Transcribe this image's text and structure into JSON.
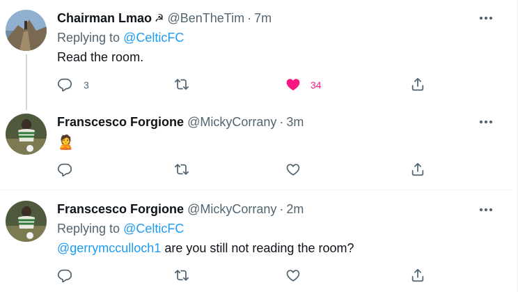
{
  "colors": {
    "text": "#0f1419",
    "secondary": "#536471",
    "link": "#1d9bf0",
    "like": "#f91880",
    "divider": "#eff3f4"
  },
  "tweets": [
    {
      "name": "Chairman Lmao",
      "name_emoji": "☭",
      "handle": "@BenTheTim",
      "dot": "·",
      "time": "7m",
      "replying_prefix": "Replying to",
      "replying_to": "@CelticFC",
      "body": "Read the room.",
      "reply_count": "3",
      "retweet_count": "",
      "like_count": "34",
      "liked": true
    },
    {
      "name": "Franscesco Forgione",
      "handle": "@MickyCorrany",
      "dot": "·",
      "time": "3m",
      "body_emoji": "🙎",
      "reply_count": "",
      "retweet_count": "",
      "like_count": "",
      "liked": false
    },
    {
      "name": "Franscesco Forgione",
      "handle": "@MickyCorrany",
      "dot": "·",
      "time": "2m",
      "replying_prefix": "Replying to",
      "replying_to": "@CelticFC",
      "mention": "@gerrymcculloch1",
      "body": " are you still not reading the room?",
      "reply_count": "",
      "retweet_count": "",
      "like_count": "",
      "liked": false
    }
  ]
}
